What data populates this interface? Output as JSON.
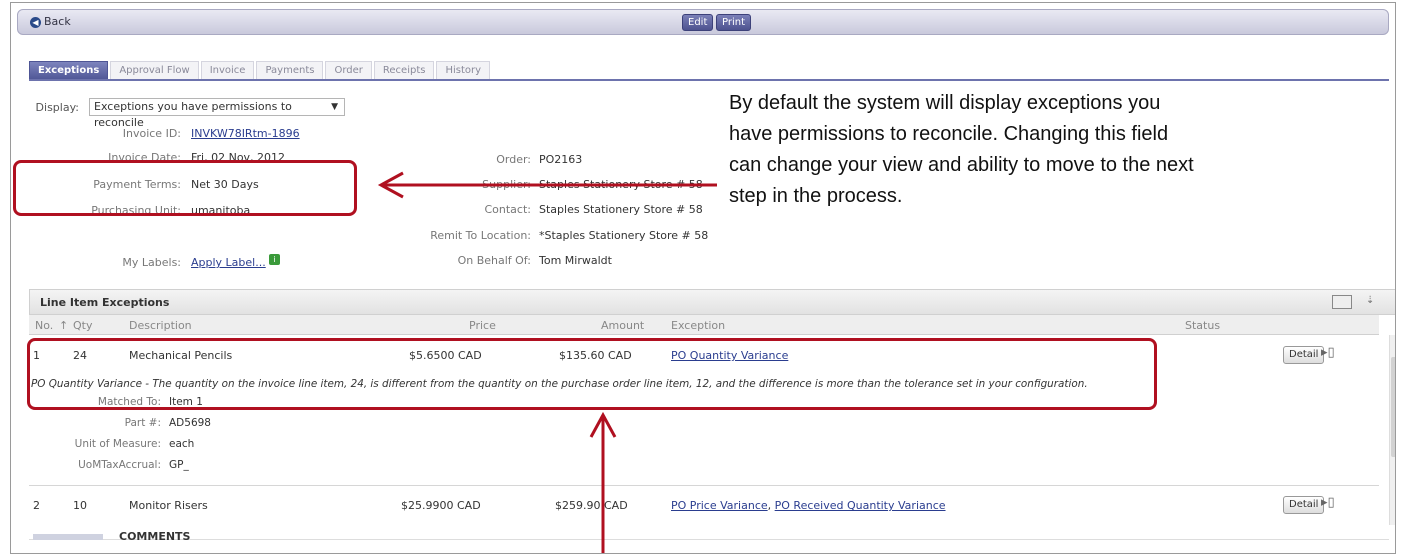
{
  "toolbar": {
    "back_label": "Back",
    "edit_label": "Edit",
    "print_label": "Print"
  },
  "tabs": [
    {
      "label": "Exceptions",
      "active": true
    },
    {
      "label": "Approval Flow"
    },
    {
      "label": "Invoice"
    },
    {
      "label": "Payments"
    },
    {
      "label": "Order"
    },
    {
      "label": "Receipts"
    },
    {
      "label": "History"
    }
  ],
  "display": {
    "label": "Display:",
    "selected": "Exceptions you have permissions to reconcile"
  },
  "invoice": {
    "invoice_id_label": "Invoice ID:",
    "invoice_id": "INVKW78IRtm-1896",
    "invoice_date_label": "Invoice Date:",
    "invoice_date": "Fri, 02 Nov, 2012",
    "payment_terms_label": "Payment Terms:",
    "payment_terms": "Net 30 Days",
    "purchasing_unit_label": "Purchasing Unit:",
    "purchasing_unit": "umanitoba",
    "my_labels_label": "My Labels:",
    "apply_label": "Apply Label..."
  },
  "order": {
    "order_label": "Order:",
    "order": "PO2163",
    "supplier_label": "Supplier:",
    "supplier": "Staples Stationery Store # 58",
    "contact_label": "Contact:",
    "contact": "Staples Stationery Store # 58",
    "remit_label": "Remit To Location:",
    "remit": "*Staples Stationery Store # 58",
    "behalf_label": "On Behalf Of:",
    "behalf": "Tom Mirwaldt"
  },
  "callout": "By default the system will display exceptions you have permissions to reconcile. Changing this field can change your view and ability to move to the next step in the process.",
  "panel": {
    "title": "Line Item Exceptions"
  },
  "columns": {
    "no": "No.",
    "qty": "Qty",
    "description": "Description",
    "price": "Price",
    "amount": "Amount",
    "exception": "Exception",
    "status": "Status"
  },
  "rows": [
    {
      "no": "1",
      "qty": "24",
      "description": "Mechanical Pencils",
      "price": "$5.6500 CAD",
      "amount": "$135.60 CAD",
      "exception": "PO Quantity Variance",
      "note": "PO Quantity Variance - The quantity on the invoice line item, 24, is different from the quantity on the purchase order line item, 12, and the difference is more than the tolerance set in your configuration.",
      "matched_label": "Matched To:",
      "matched": "Item 1",
      "part_label": "Part #:",
      "part": "AD5698",
      "uom_label": "Unit of Measure:",
      "uom": "each",
      "uomtax_label": "UoMTaxAccrual:",
      "uomtax": "GP_",
      "detail_label": "Detail"
    },
    {
      "no": "2",
      "qty": "10",
      "description": "Monitor Risers",
      "price": "$25.9900 CAD",
      "amount": "$259.90 CAD",
      "exception_a": "PO Price Variance",
      "exception_sep": ", ",
      "exception_b": "PO Received Quantity Variance",
      "detail_label": "Detail"
    }
  ],
  "comments_label": "COMMENTS",
  "colors": {
    "accent": "#4e5595",
    "callout_box": "#b01020"
  }
}
